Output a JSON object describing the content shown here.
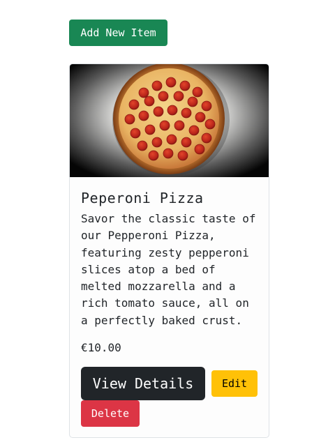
{
  "toolbar": {
    "add_label": "Add New Item"
  },
  "card": {
    "image_name": "pepperoni-pizza-photo",
    "title": "Peperoni Pizza",
    "description": "Savor the classic taste of our Pepperoni Pizza, featuring zesty pepperoni slices atop a bed of melted mozzarella and a rich tomato sauce, all on a perfectly baked crust.",
    "price": "€10.00",
    "view_label": "View Details",
    "edit_label": "Edit",
    "delete_label": "Delete"
  },
  "colors": {
    "add_button": "#198754",
    "view_button": "#212529",
    "edit_button": "#ffc107",
    "delete_button": "#dc3545"
  }
}
